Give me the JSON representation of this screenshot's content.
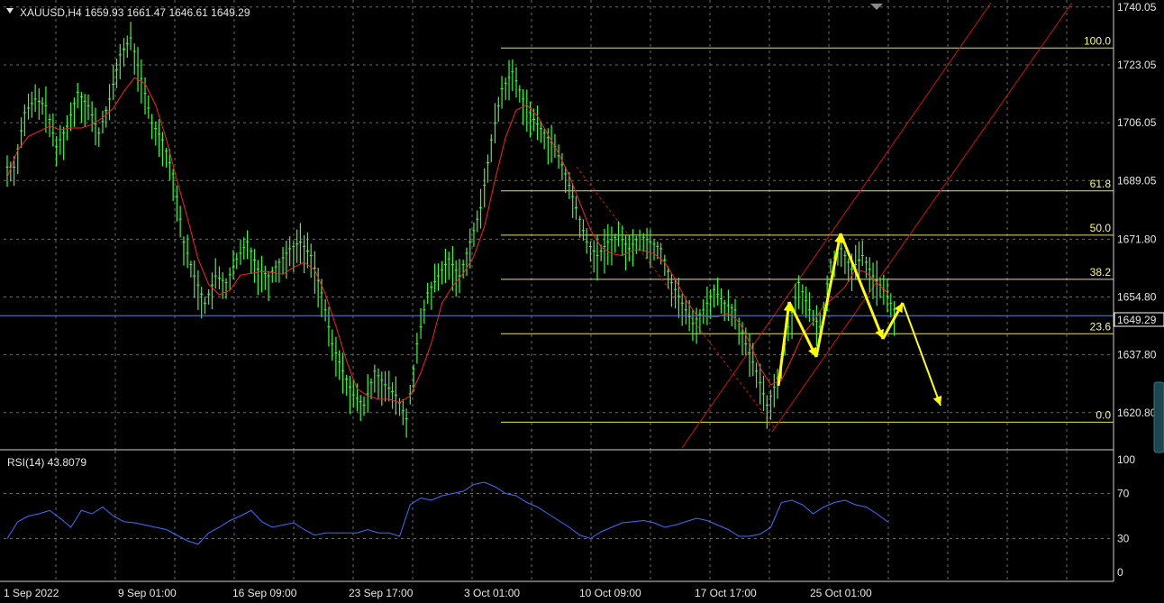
{
  "colors": {
    "background": "#000000",
    "candles": "#33ff33",
    "ma": "#ff2020",
    "fibo": "#e6e650",
    "arrows": "#ffff00",
    "rsi": "#3d6fff",
    "grid": "#6a6a6a",
    "text": "#e6e6e6",
    "channel": "#d01010"
  },
  "header": {
    "symbol_label": "XAUUSD,H4  1659.93 1661.47 1646.61 1649.29"
  },
  "price_badge": "1649.29",
  "rsi_label": "RSI(14) 43.8079",
  "chart_data": [
    {
      "type": "line",
      "series": [
        {
          "values": [
            1692,
            1708,
            1712,
            1710,
            1698,
            1704,
            1714,
            1710,
            1702,
            1712,
            1725,
            1730,
            1718,
            1705,
            1700,
            1690,
            1670,
            1660,
            1652,
            1660,
            1658,
            1665,
            1670,
            1662,
            1660,
            1664,
            1668,
            1670,
            1666,
            1655,
            1640,
            1632,
            1625,
            1622,
            1632,
            1628,
            1625,
            1618,
            1640,
            1655,
            1660,
            1665,
            1660,
            1670,
            1680,
            1700,
            1715,
            1720,
            1712,
            1706,
            1702,
            1698,
            1690,
            1680,
            1670,
            1666,
            1670,
            1672,
            1668,
            1672,
            1670,
            1668,
            1658,
            1652,
            1646,
            1650,
            1656,
            1652,
            1650,
            1640,
            1632,
            1622,
            1630,
            1645,
            1658,
            1650,
            1645,
            1664,
            1668,
            1662,
            1666,
            1660,
            1656,
            1650
          ]
        }
      ],
      "markers": {
        "lastPrice": 1649.29,
        "fibRange": [
          1618,
          1728
        ]
      },
      "ylim": [
        1612,
        1740
      ],
      "ytick_labels": [
        "1740.05",
        "1723.05",
        "1706.05",
        "1689.05",
        "1671.80",
        "1654.80",
        "1637.80",
        "1620.80"
      ],
      "xtick_labels": [
        "1 Sep 2022",
        "9 Sep 01:00",
        "16 Sep 09:00",
        "23 Sep 17:00",
        "3 Oct 01:00",
        "10 Oct 09:00",
        "17 Oct 17:00",
        "25 Oct 01:00"
      ],
      "fib_levels": [
        {
          "label": "100.0",
          "value": 1728.0
        },
        {
          "label": "61.8",
          "value": 1686.0
        },
        {
          "label": "50.0",
          "value": 1673.0
        },
        {
          "label": "38.2",
          "value": 1660.0
        },
        {
          "label": "23.6",
          "value": 1644.0
        },
        {
          "label": "0.0",
          "value": 1618.0
        }
      ],
      "arrows": [
        {
          "from": [
            1616,
            1626
          ],
          "to": [
            1612,
            1658
          ]
        },
        {
          "from": [
            1612,
            1658
          ],
          "to": [
            1610,
            1641
          ]
        },
        {
          "from": [
            1610,
            1641
          ],
          "to": [
            1608,
            1673
          ]
        },
        {
          "from": [
            1608,
            1673
          ],
          "to": [
            1606,
            1644
          ]
        },
        {
          "from": [
            1606,
            1644
          ],
          "to": [
            1604,
            1657
          ]
        },
        {
          "from": [
            1604,
            1657
          ],
          "to": [
            1602,
            1625
          ]
        }
      ]
    },
    {
      "type": "line",
      "series": [
        {
          "values": [
            30,
            45,
            50,
            52,
            55,
            48,
            40,
            55,
            52,
            58,
            50,
            45,
            44,
            42,
            40,
            38,
            33,
            28,
            25,
            35,
            40,
            46,
            50,
            55,
            45,
            40,
            42,
            44,
            38,
            33,
            35,
            35,
            35,
            35,
            38,
            35,
            35,
            32,
            60,
            66,
            64,
            68,
            70,
            72,
            78,
            80,
            76,
            70,
            68,
            62,
            58,
            52,
            46,
            40,
            33,
            30,
            36,
            40,
            44,
            45,
            46,
            44,
            40,
            42,
            45,
            48,
            46,
            42,
            38,
            32,
            32,
            34,
            40,
            62,
            64,
            60,
            52,
            58,
            62,
            64,
            60,
            58,
            52,
            45
          ]
        }
      ],
      "ylim": [
        0,
        100
      ],
      "ytick_labels": [
        "100",
        "70",
        "30",
        "0"
      ]
    }
  ]
}
